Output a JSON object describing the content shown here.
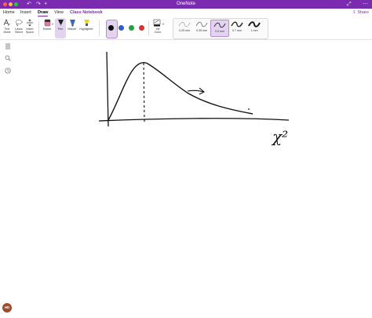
{
  "window": {
    "app_title": "OneNote",
    "traffic_lights": [
      "close",
      "minimize",
      "zoom"
    ],
    "toolbar_icons": [
      "undo-icon",
      "redo-icon",
      "dropdown-icon",
      "expand-icon",
      "more-icon"
    ]
  },
  "menu": {
    "tabs": [
      {
        "label": "Home",
        "active": false
      },
      {
        "label": "Insert",
        "active": false
      },
      {
        "label": "Draw",
        "active": true
      },
      {
        "label": "View",
        "active": false
      },
      {
        "label": "Class Notebook",
        "active": false
      }
    ],
    "share_label": "Share"
  },
  "ribbon": {
    "tools": [
      {
        "label_line1": "Text",
        "label_line2": "Mode",
        "icon": "text-mode-icon"
      },
      {
        "label_line1": "Lasso",
        "label_line2": "Select",
        "icon": "lasso-select-icon"
      },
      {
        "label_line1": "Insert",
        "label_line2": "Space",
        "icon": "insert-space-icon"
      }
    ],
    "pens": [
      {
        "label": "Eraser",
        "icon": "eraser-icon"
      },
      {
        "label": "Pen",
        "icon": "pen-icon",
        "selected": true
      },
      {
        "label": "Marker",
        "icon": "marker-icon"
      },
      {
        "label": "Highlighter",
        "icon": "highlighter-icon"
      }
    ],
    "colors": [
      {
        "name": "black",
        "hex": "#111111",
        "selected": true
      },
      {
        "name": "blue",
        "hex": "#2d5fd0"
      },
      {
        "name": "green",
        "hex": "#2e9e44"
      },
      {
        "name": "red",
        "hex": "#d9342b"
      }
    ],
    "ink_color_line1": "Ink",
    "ink_color_line2": "Color",
    "thicknesses": [
      {
        "label": "0.25 mm",
        "selected": false
      },
      {
        "label": "0.35 mm",
        "selected": false
      },
      {
        "label": "0.5 mm",
        "selected": true
      },
      {
        "label": "0.7 mm",
        "selected": false
      },
      {
        "label": "1 mm",
        "selected": false
      }
    ]
  },
  "sidebar": {
    "icons": [
      "notebooks-icon",
      "search-icon",
      "recent-icon"
    ],
    "avatar_initials": "HD"
  },
  "canvas": {
    "sketch_label": "χ²"
  },
  "colors": {
    "accent": "#7a2bb0",
    "selected_bg": "#e3d3f0"
  }
}
